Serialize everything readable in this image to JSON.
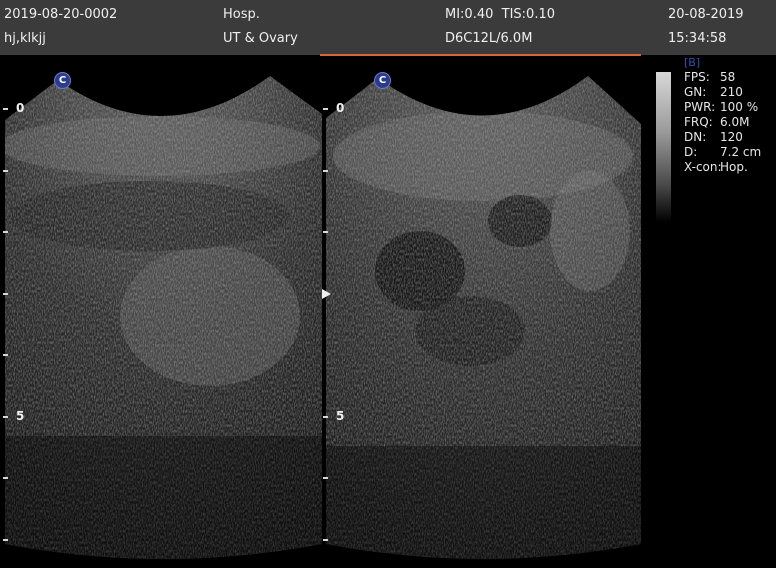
{
  "header": {
    "patient_id": "2019-08-20-0002",
    "patient_name": "hj,klkjj",
    "institution": "Hosp.",
    "exam": "UT & Ovary",
    "indices": "MI:0.40  TIS:0.10",
    "probe": "D6C12L/6.0M",
    "date": "20-08-2019",
    "time": "15:34:58"
  },
  "params": {
    "mode": "[B]",
    "rows": [
      {
        "key": "FPS:",
        "value": "58"
      },
      {
        "key": "GN:",
        "value": "210"
      },
      {
        "key": "PWR:",
        "value": "100 %"
      },
      {
        "key": "FRQ:",
        "value": "6.0M"
      },
      {
        "key": "DN:",
        "value": "120"
      },
      {
        "key": "D:",
        "value": "7.2 cm"
      },
      {
        "key": "X-con:",
        "value": "Hop."
      }
    ]
  },
  "images": {
    "left": {
      "badge": "C",
      "depth_top": "0",
      "depth_mid": "5"
    },
    "right": {
      "badge": "C",
      "depth_top": "0",
      "depth_mid": "5"
    }
  },
  "colors": {
    "header_bg": "#3b3b3b",
    "active_underline": "#d9643a",
    "mode_label": "#3850a8",
    "badge": "#2d3c8a"
  }
}
